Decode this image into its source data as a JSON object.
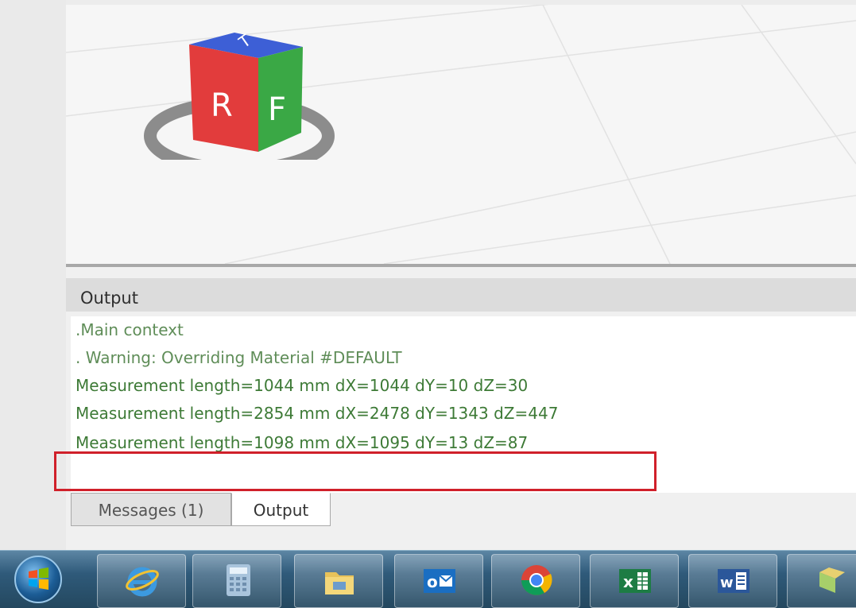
{
  "viewcube": {
    "faces": {
      "top": "T",
      "right": "R",
      "front": "F"
    },
    "colors": {
      "top": "#3d5fd6",
      "right": "#e23c3c",
      "front": "#3aa845",
      "ring": "#8c8c8c"
    }
  },
  "output_panel": {
    "title": "Output",
    "lines": [
      ".Main context",
      ". Warning: Overriding Material  #DEFAULT",
      "Measurement length=1044 mm dX=1044 dY=10 dZ=30",
      "Measurement length=2854 mm dX=2478 dY=1343 dZ=447",
      "Measurement length=1098 mm dX=1095 dY=13 dZ=87"
    ],
    "highlighted_line_index": 4,
    "highlight_color": "#d0202a",
    "text_color": "#3d7a36"
  },
  "tabs": [
    {
      "label": "Messages (1)",
      "active": false
    },
    {
      "label": "Output",
      "active": true
    }
  ],
  "taskbar": {
    "start_icon": "windows-start-orb-icon",
    "apps": [
      {
        "icon": "internet-explorer-icon"
      },
      {
        "icon": "calculator-icon"
      },
      {
        "icon": "file-explorer-icon"
      },
      {
        "icon": "outlook-icon",
        "glyph": "o"
      },
      {
        "icon": "chrome-icon"
      },
      {
        "icon": "excel-icon",
        "glyph": "x"
      },
      {
        "icon": "word-icon",
        "glyph": "w"
      },
      {
        "icon": "windows-explorer-icon"
      }
    ]
  }
}
